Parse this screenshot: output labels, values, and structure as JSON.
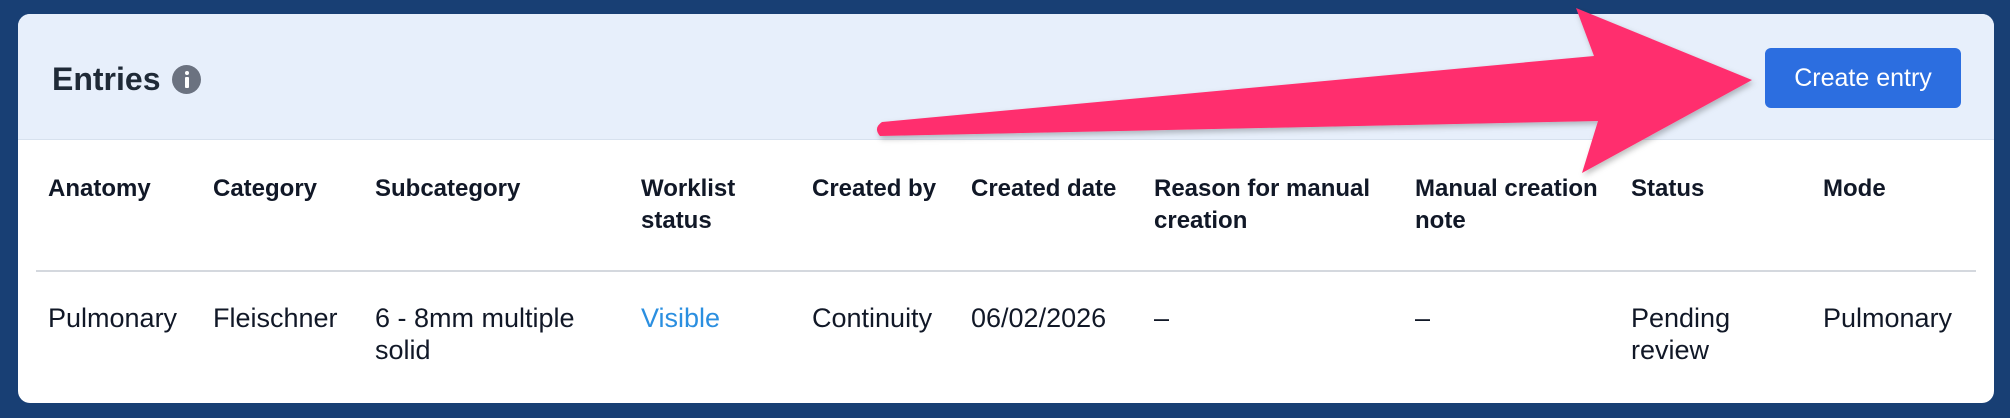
{
  "header": {
    "title": "Entries",
    "create_button": "Create entry"
  },
  "table": {
    "columns": [
      "Anatomy",
      "Category",
      "Subcategory",
      "Worklist status",
      "Created by",
      "Created date",
      "Reason for manual creation",
      "Manual creation note",
      "Status",
      "Mode"
    ],
    "rows": [
      {
        "anatomy": "Pulmonary",
        "category": "Fleischner",
        "subcategory": "6 - 8mm multiple solid",
        "worklist_status": "Visible",
        "created_by": "Continuity",
        "created_date": "06/02/2026",
        "reason": "–",
        "note": "–",
        "status": "Pending review",
        "mode": "Pulmonary"
      }
    ]
  },
  "colors": {
    "background": "#183f74",
    "header_bg": "#e7effb",
    "button": "#2c6ee0",
    "link": "#2b8fe0",
    "annotation_arrow": "#ff2f6e"
  },
  "icons": {
    "title_info": "info-icon",
    "annotation": "arrow-annotation"
  }
}
